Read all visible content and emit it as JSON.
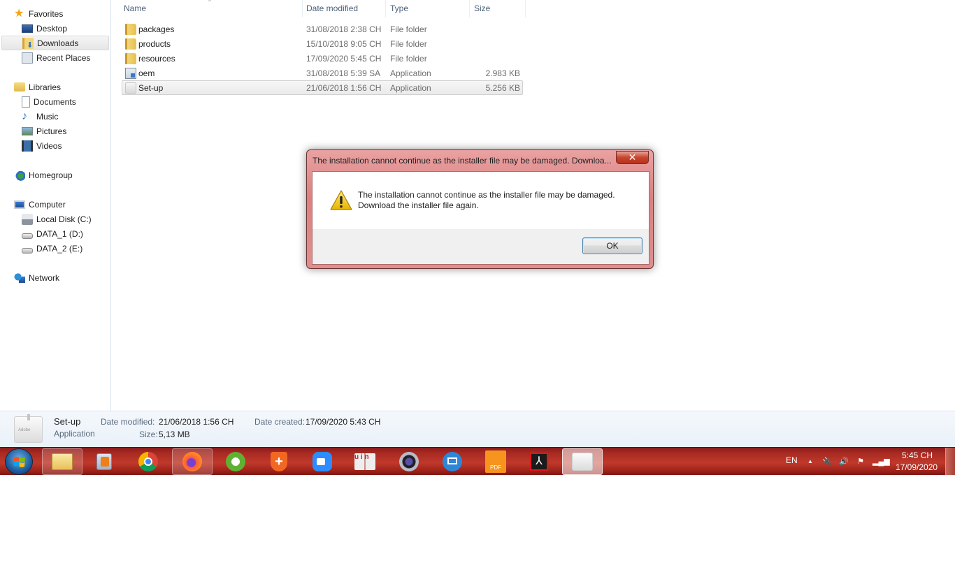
{
  "explorer": {
    "nav": {
      "favorites": {
        "label": "Favorites",
        "items": [
          {
            "label": "Desktop",
            "icon": "desktop-icon"
          },
          {
            "label": "Downloads",
            "icon": "downloads-icon",
            "selected": true
          },
          {
            "label": "Recent Places",
            "icon": "recent-places-icon"
          }
        ]
      },
      "libraries": {
        "label": "Libraries",
        "items": [
          {
            "label": "Documents",
            "icon": "documents-icon"
          },
          {
            "label": "Music",
            "icon": "music-icon"
          },
          {
            "label": "Pictures",
            "icon": "pictures-icon"
          },
          {
            "label": "Videos",
            "icon": "videos-icon"
          }
        ]
      },
      "homegroup": {
        "label": "Homegroup"
      },
      "computer": {
        "label": "Computer",
        "items": [
          {
            "label": "Local Disk (C:)",
            "icon": "local-disk-icon"
          },
          {
            "label": "DATA_1 (D:)",
            "icon": "drive-icon"
          },
          {
            "label": "DATA_2 (E:)",
            "icon": "drive-icon"
          }
        ]
      },
      "network": {
        "label": "Network"
      }
    },
    "columns": {
      "name": "Name",
      "date": "Date modified",
      "type": "Type",
      "size": "Size"
    },
    "files": [
      {
        "name": "packages",
        "date": "31/08/2018 2:38 CH",
        "type": "File folder",
        "size": "",
        "kind": "folder"
      },
      {
        "name": "products",
        "date": "15/10/2018 9:05 CH",
        "type": "File folder",
        "size": "",
        "kind": "folder"
      },
      {
        "name": "resources",
        "date": "17/09/2020 5:45 CH",
        "type": "File folder",
        "size": "",
        "kind": "folder"
      },
      {
        "name": "oem",
        "date": "31/08/2018 5:39 SA",
        "type": "Application",
        "size": "2.983 KB",
        "kind": "app"
      },
      {
        "name": "Set-up",
        "date": "21/06/2018 1:56 CH",
        "type": "Application",
        "size": "5.256 KB",
        "kind": "setup",
        "selected": true
      }
    ],
    "details": {
      "name": "Set-up",
      "type": "Application",
      "icon_text": "Adobe",
      "date_modified_label": "Date modified:",
      "date_modified": "21/06/2018 1:56 CH",
      "date_created_label": "Date created:",
      "date_created": "17/09/2020 5:43 CH",
      "size_label": "Size:",
      "size": "5,13 MB"
    }
  },
  "dialog": {
    "title": "The installation cannot continue as the installer file may be damaged. Downloa...",
    "close_label": "✕",
    "message_line1": "The installation cannot continue as the installer file may be damaged.",
    "message_line2": "Download the installer file again.",
    "ok_label": "OK"
  },
  "taskbar": {
    "apps": [
      {
        "name": "windows-explorer",
        "active": true
      },
      {
        "name": "media-player"
      },
      {
        "name": "chrome"
      },
      {
        "name": "firefox",
        "active": true
      },
      {
        "name": "coc-coc"
      },
      {
        "name": "security-shield"
      },
      {
        "name": "zoom"
      },
      {
        "name": "unikey"
      },
      {
        "name": "webcam"
      },
      {
        "name": "remote-desktop"
      },
      {
        "name": "foxit-pdf"
      },
      {
        "name": "adobe-acrobat"
      },
      {
        "name": "adobe-installer",
        "active": true
      }
    ],
    "tray": {
      "language": "EN",
      "time": "5:45 CH",
      "date": "17/09/2020"
    }
  }
}
